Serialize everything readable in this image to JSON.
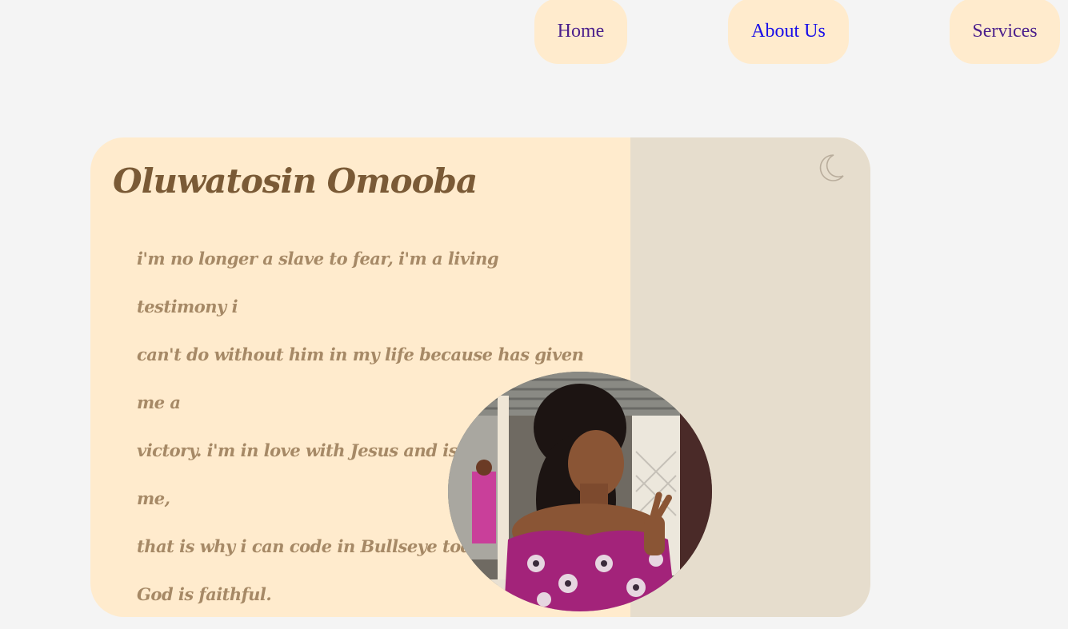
{
  "nav": {
    "home": "Home",
    "about": "About Us",
    "services": "Services"
  },
  "profile": {
    "name": "Oluwatosin Omooba",
    "bio_lines": [
      "i'm no longer a slave to fear, i'm a living testimony i",
      "can't do without him in my life because has given me a",
      "victory. i'm in love with Jesus and is in love with me,",
      "that is why i can code in Bullseye today.",
      "God is faithful."
    ]
  },
  "icons": {
    "theme_toggle": "moon-icon"
  },
  "colors": {
    "page_bg": "#f4f4f4",
    "card_bg": "#ffebcd",
    "card_side": "#e6ddcd",
    "name_text": "#7a5a36",
    "bio_text": "#a68966",
    "nav_link": "#4b1f8c",
    "nav_link_active": "#1a0ee8"
  }
}
